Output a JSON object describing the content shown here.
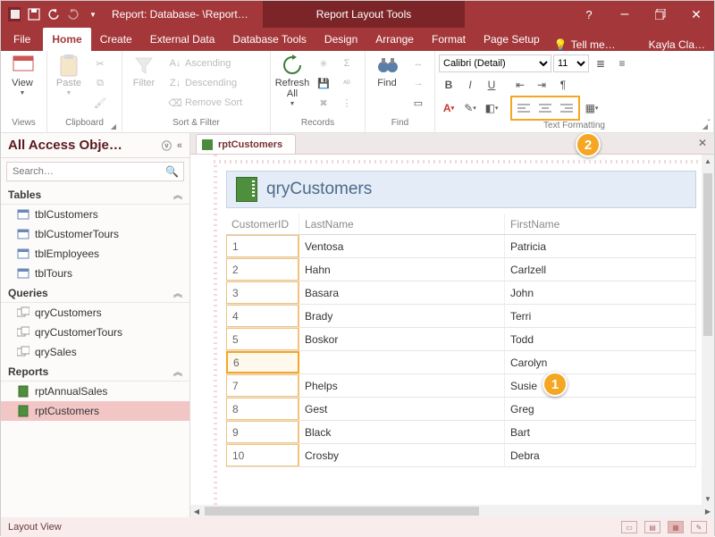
{
  "titlebar": {
    "title": "Report: Database- \\Report…",
    "context_tab": "Report Layout Tools"
  },
  "tabs": {
    "file": "File",
    "home": "Home",
    "create": "Create",
    "external": "External Data",
    "dbtools": "Database Tools",
    "design": "Design",
    "arrange": "Arrange",
    "format": "Format",
    "pagesetup": "Page Setup",
    "tellme": "Tell me…",
    "user": "Kayla Cla…"
  },
  "ribbon": {
    "views": {
      "label": "Views",
      "btn": "View"
    },
    "clipboard": {
      "label": "Clipboard",
      "paste": "Paste"
    },
    "sortfilter": {
      "label": "Sort & Filter",
      "filter": "Filter",
      "asc": "Ascending",
      "desc": "Descending",
      "remove": "Remove Sort"
    },
    "records": {
      "label": "Records",
      "refresh": "Refresh\nAll"
    },
    "find": {
      "label": "Find",
      "find": "Find"
    },
    "textfmt": {
      "label": "Text Formatting",
      "font": "Calibri (Detail)",
      "size": "11"
    }
  },
  "nav": {
    "header": "All Access Obje…",
    "search_placeholder": "Search…",
    "groups": {
      "tables": {
        "label": "Tables",
        "items": [
          "tblCustomers",
          "tblCustomerTours",
          "tblEmployees",
          "tblTours"
        ]
      },
      "queries": {
        "label": "Queries",
        "items": [
          "qryCustomers",
          "qryCustomerTours",
          "qrySales"
        ]
      },
      "reports": {
        "label": "Reports",
        "items": [
          "rptAnnualSales",
          "rptCustomers"
        ]
      }
    }
  },
  "doc": {
    "tab": "rptCustomers",
    "title": "qryCustomers",
    "columns": [
      "CustomerID",
      "LastName",
      "FirstName"
    ],
    "rows": [
      {
        "id": "1",
        "last": "Ventosa",
        "first": "Patricia"
      },
      {
        "id": "2",
        "last": "Hahn",
        "first": "Carlzell"
      },
      {
        "id": "3",
        "last": "Basara",
        "first": "John"
      },
      {
        "id": "4",
        "last": "Brady",
        "first": "Terri"
      },
      {
        "id": "5",
        "last": "Boskor",
        "first": "Todd"
      },
      {
        "id": "6",
        "last": "",
        "first": "Carolyn"
      },
      {
        "id": "7",
        "last": "Phelps",
        "first": "Susie"
      },
      {
        "id": "8",
        "last": "Gest",
        "first": "Greg"
      },
      {
        "id": "9",
        "last": "Black",
        "first": "Bart"
      },
      {
        "id": "10",
        "last": "Crosby",
        "first": "Debra"
      }
    ],
    "selected_row": 5
  },
  "callouts": {
    "one": "1",
    "two": "2"
  },
  "status": {
    "mode": "Layout View"
  }
}
